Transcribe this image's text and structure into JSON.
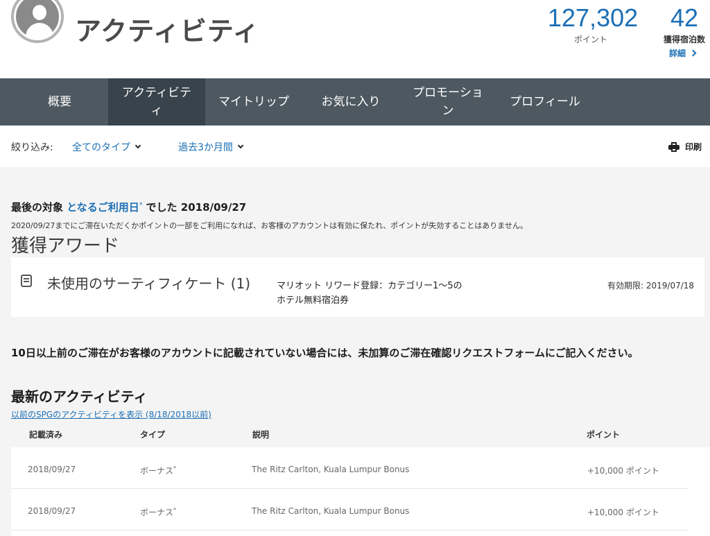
{
  "header": {
    "title": "アクティビティ",
    "points_value": "127,302",
    "points_label": "ポイント",
    "nights_value": "42",
    "nights_label": "獲得宿泊数",
    "details_link": "詳細"
  },
  "nav": {
    "tabs": [
      {
        "label": "概要",
        "active": false
      },
      {
        "label": "アクティビティ",
        "active": true
      },
      {
        "label": "マイトリップ",
        "active": false
      },
      {
        "label": "お気に入り",
        "active": false
      },
      {
        "label": "プロモーション",
        "active": false
      },
      {
        "label": "プロフィール",
        "active": false
      }
    ]
  },
  "filters": {
    "label": "絞り込み:",
    "type_value": "全てのタイプ",
    "period_value": "過去3か月間",
    "print_label": "印刷"
  },
  "last_activity": {
    "prefix": "最後の対象",
    "highlight": "となるご利用日",
    "mark": "*",
    "suffix": "でした 2018/09/27",
    "note": "2020/09/27までにご滞在いただくかポイントの一部をご利用になれば、お客様のアカウントは有効に保たれ、ポイントが失効することはありません。"
  },
  "awards": {
    "title": "獲得アワード",
    "certificate_name": "未使用のサーティフィケート (1)",
    "certificate_desc": "マリオット リワード登録：カテゴリー1〜5のホテル無料宿泊券",
    "certificate_expiry": "有効期限: 2019/07/18"
  },
  "request_note": "10日以上前のご滞在がお客様のアカウントに記載されていない場合には、未加算のご滞在確認リクエストフォームにご記入ください。",
  "recent": {
    "title": "最新のアクティビティ",
    "spg_link": "以前のSPGのアクティビティを表示 (8/18/2018以前)",
    "columns": {
      "posted": "記載済み",
      "type": "タイプ",
      "description": "説明",
      "points": "ポイント"
    },
    "rows": [
      {
        "posted": "2018/09/27",
        "type": "ボーナス",
        "type_mark": "*",
        "description": "The Ritz Carlton, Kuala Lumpur Bonus",
        "points": "+10,000 ポイント"
      },
      {
        "posted": "2018/09/27",
        "type": "ボーナス",
        "type_mark": "*",
        "description": "The Ritz Carlton, Kuala Lumpur Bonus",
        "points": "+10,000 ポイント"
      }
    ]
  },
  "colors": {
    "accent": "#1c6fb5",
    "nav_bg": "#4d5860",
    "nav_active_bg": "#39434b"
  }
}
